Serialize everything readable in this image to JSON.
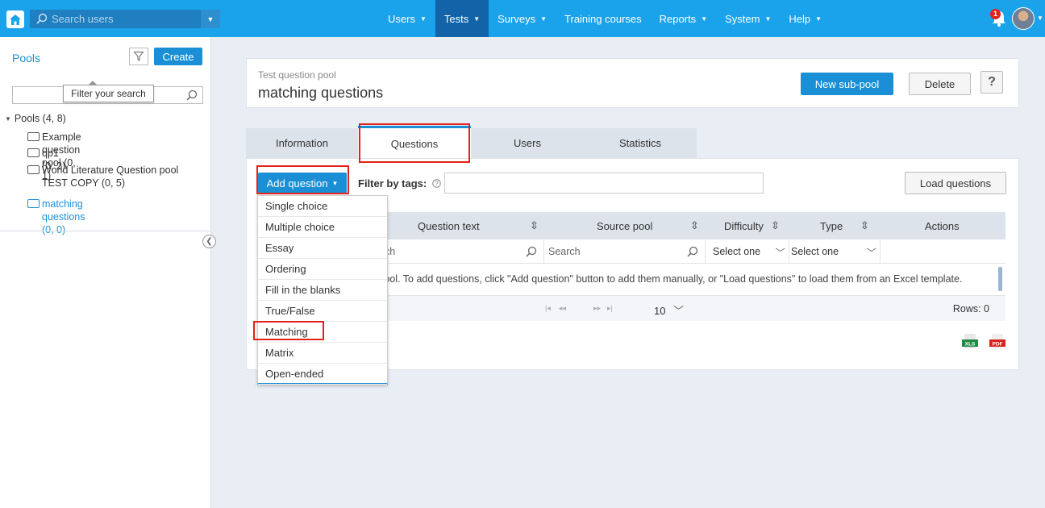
{
  "topbar": {
    "search_placeholder": "Search users",
    "nav": [
      {
        "label": "Users",
        "caret": true,
        "active": false
      },
      {
        "label": "Tests",
        "caret": true,
        "active": true
      },
      {
        "label": "Surveys",
        "caret": true,
        "active": false
      },
      {
        "label": "Training courses",
        "caret": false,
        "active": false
      },
      {
        "label": "Reports",
        "caret": true,
        "active": false
      },
      {
        "label": "System",
        "caret": true,
        "active": false
      },
      {
        "label": "Help",
        "caret": true,
        "active": false
      }
    ],
    "notification_count": "1",
    "accent_color": "#1aa3ea",
    "active_nav_color": "#1363a8"
  },
  "sidebar": {
    "title": "Pools",
    "create_label": "Create",
    "filter_tooltip": "Filter your search",
    "tree": {
      "root": "Pools (4, 8)",
      "items": [
        {
          "label": "Example question pool (0, 1)",
          "selected": false
        },
        {
          "label": "qp1 (0, 2)",
          "selected": false
        },
        {
          "label": "World Literature Question pool TEST COPY (0, 5)",
          "selected": false
        },
        {
          "label": "matching questions (0, 0)",
          "selected": true
        }
      ]
    }
  },
  "header": {
    "subtitle": "Test question pool",
    "title": "matching questions",
    "new_subpool_label": "New sub-pool",
    "delete_label": "Delete",
    "help_label": "?"
  },
  "tabs": [
    {
      "label": "Information",
      "active": false
    },
    {
      "label": "Questions",
      "active": true
    },
    {
      "label": "Users",
      "active": false
    },
    {
      "label": "Statistics",
      "active": false
    }
  ],
  "toolbar": {
    "add_question_label": "Add question",
    "filter_by_tags_label": "Filter by tags:",
    "load_questions_label": "Load questions"
  },
  "table": {
    "columns": [
      {
        "label": "Question text",
        "sortable": true
      },
      {
        "label": "Source pool",
        "sortable": true
      },
      {
        "label": "Difficulty",
        "sortable": true
      },
      {
        "label": "Type",
        "sortable": true
      },
      {
        "label": "Actions",
        "sortable": false
      }
    ],
    "filters": {
      "question_text_partial": "ch",
      "source_pool_placeholder": "Search",
      "difficulty_select": "Select one",
      "type_select": "Select one"
    },
    "empty_message": "his pool. To add questions, click \"Add question\" button to add them manually, or \"Load questions\" to load them from an Excel template.",
    "page_size": "10",
    "rows_label": "Rows: 0"
  },
  "add_question_menu": [
    "Single choice",
    "Multiple choice",
    "Essay",
    "Ordering",
    "Fill in the blanks",
    "True/False",
    "Matching",
    "Matrix",
    "Open-ended"
  ],
  "highlight_color": "#e2231a"
}
